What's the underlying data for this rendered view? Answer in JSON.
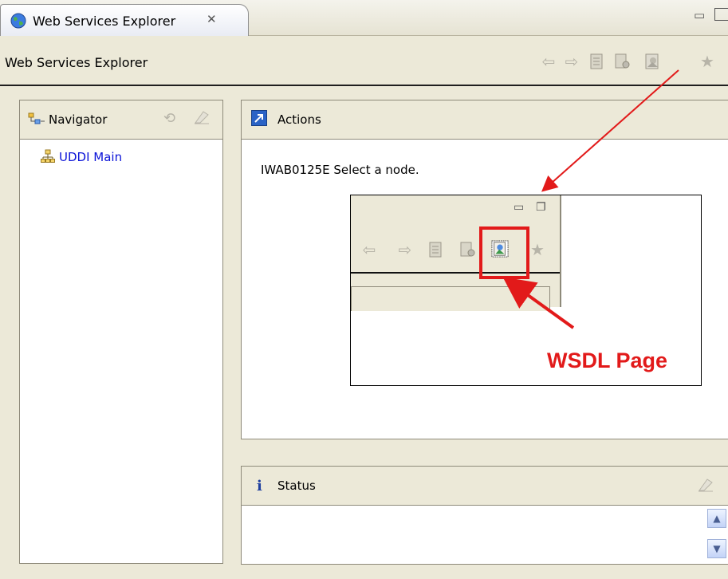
{
  "tab": {
    "title": "Web Services Explorer",
    "close_glyph": "✕"
  },
  "toolbar": {
    "title": "Web Services Explorer",
    "icons": [
      "back-arrow-icon",
      "forward-arrow-icon",
      "page-icon",
      "page-settings-icon",
      "wsdl-page-icon",
      "favorites-star-icon"
    ]
  },
  "navigator": {
    "title": "Navigator",
    "items": [
      {
        "label": "UDDI Main"
      }
    ]
  },
  "actions": {
    "title": "Actions",
    "message": "IWAB0125E Select a node."
  },
  "status": {
    "title": "Status",
    "info_glyph": "i"
  },
  "callout": {
    "label": "WSDL Page",
    "color": "#e21a1a"
  },
  "colors": {
    "link": "#0a12d8",
    "background": "#ece9d8"
  }
}
